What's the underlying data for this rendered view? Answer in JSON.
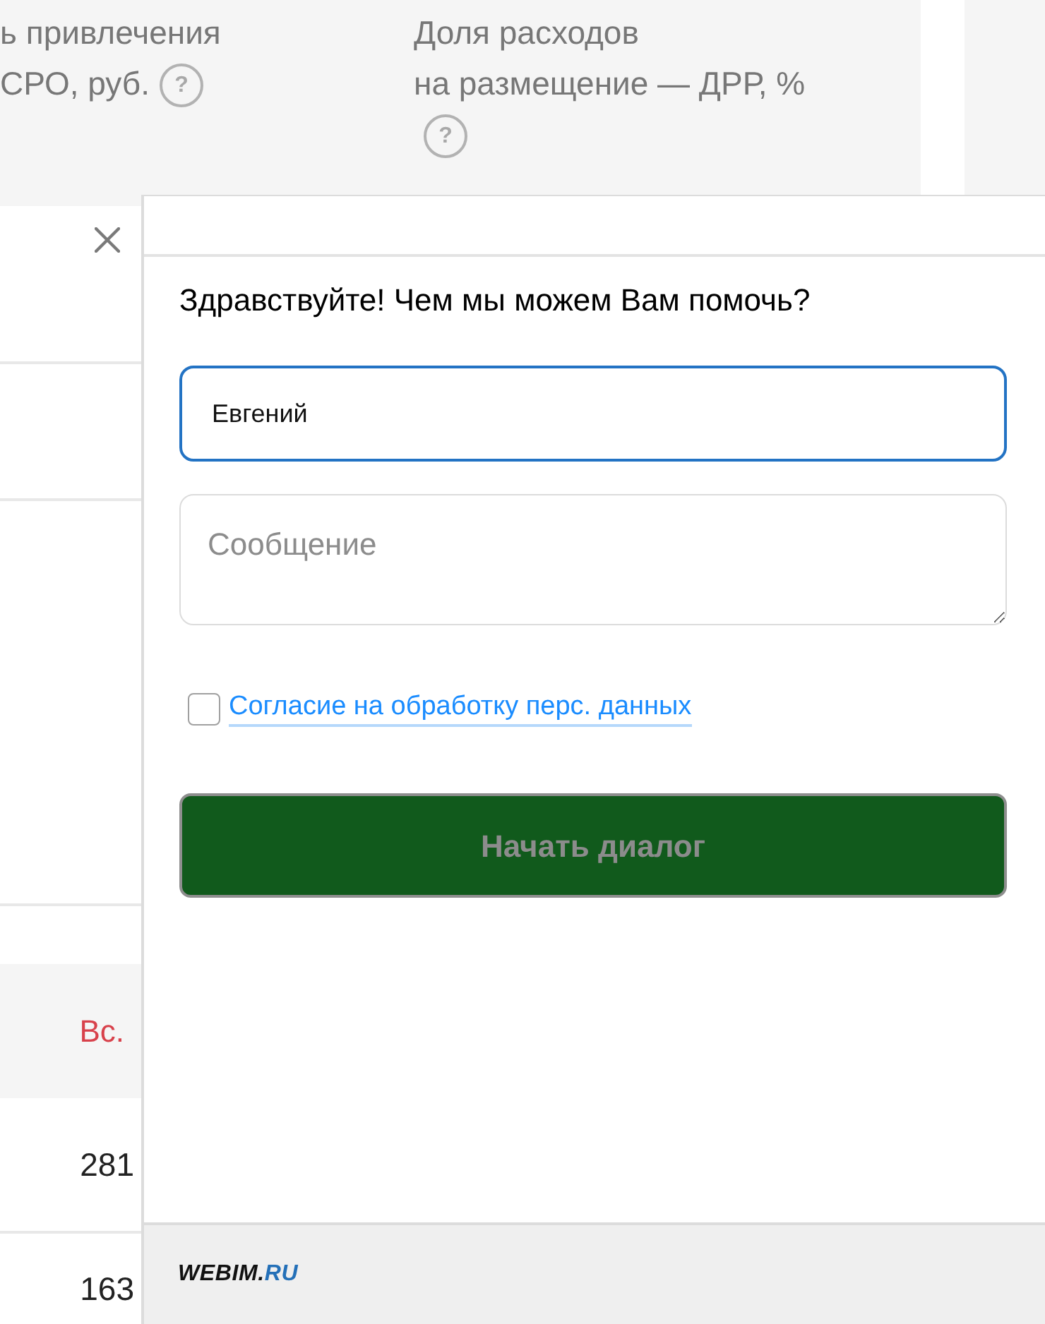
{
  "table_header": {
    "columns": [
      {
        "lines": [
          "ь привлечения",
          "СРО, руб."
        ],
        "help": "?"
      },
      {
        "lines": [
          "Доля расходов",
          "на размещение — ДРР, %"
        ],
        "help": "?"
      }
    ]
  },
  "table": {
    "day_header": {
      "label": "Вс.",
      "weekend": true
    },
    "rows": [
      {
        "value": "281"
      },
      {
        "value": "163"
      }
    ]
  },
  "chat": {
    "greeting": "Здравствуйте! Чем мы можем Вам помочь?",
    "name_field": {
      "value": "Евгений",
      "focused": true
    },
    "message_field": {
      "placeholder": "Сообщение"
    },
    "consent": {
      "label": "Согласие на обработку перс. данных",
      "checked": false
    },
    "start_button": {
      "label": "Начать диалог",
      "disabled": true
    },
    "footer": {
      "logo": {
        "text": "WEBIM.",
        "accent": "RU"
      }
    }
  }
}
